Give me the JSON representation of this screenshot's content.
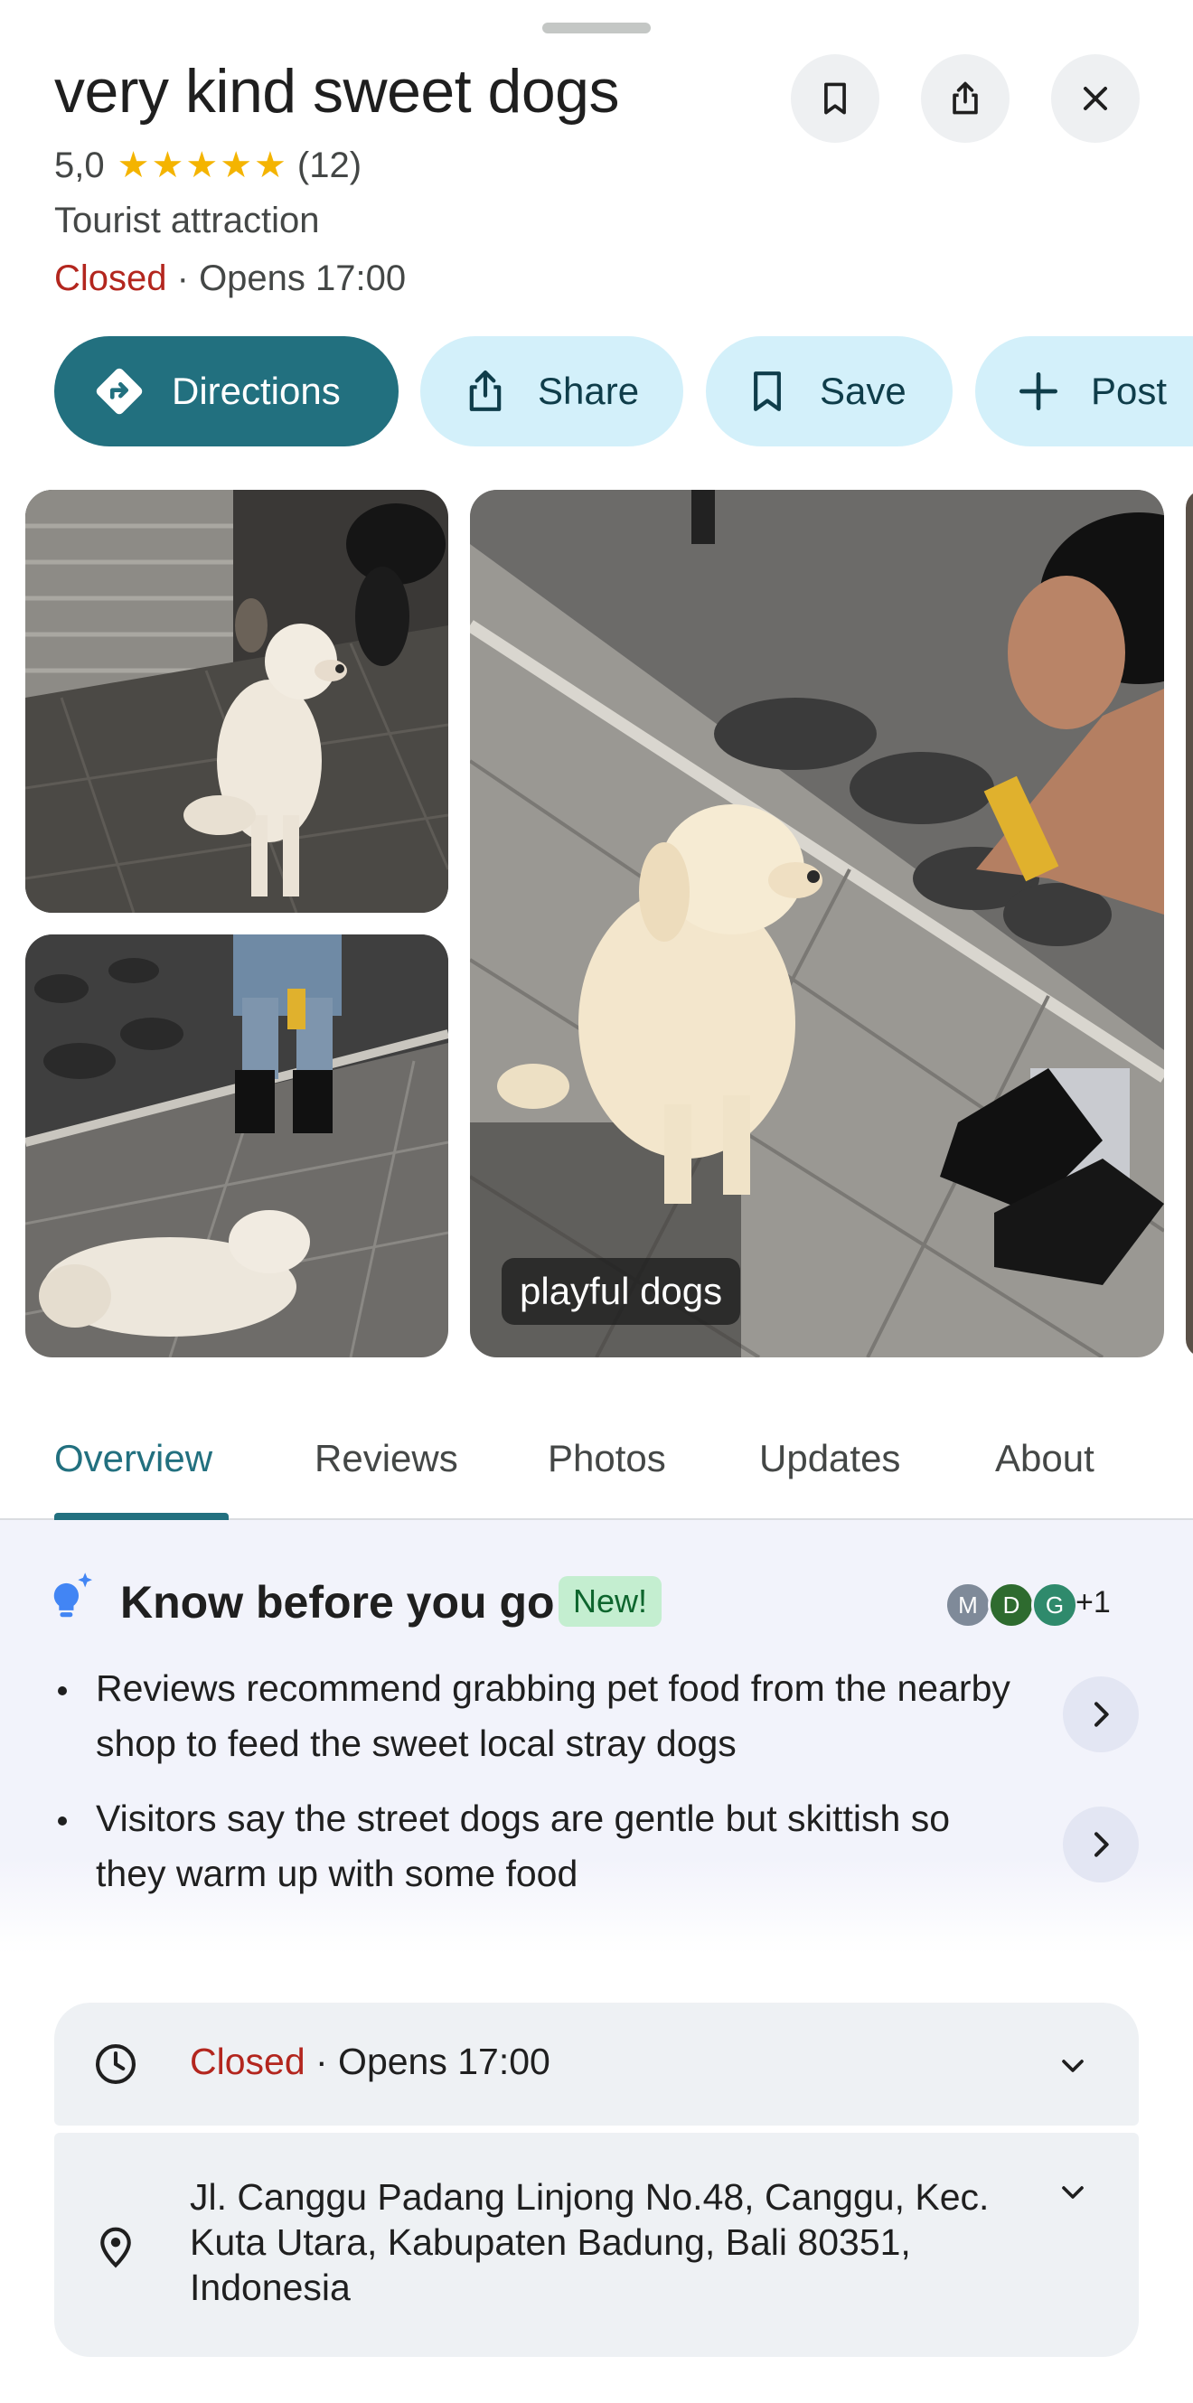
{
  "place": {
    "name": "very kind sweet dogs",
    "rating": "5,0",
    "stars": "★★★★★",
    "review_count": "(12)",
    "category": "Tourist attraction",
    "status": "Closed",
    "opens": " · Opens 17:00"
  },
  "header_buttons": [
    "bookmark-icon",
    "share-icon",
    "close-icon"
  ],
  "actions": {
    "directions": "Directions",
    "share": "Share",
    "save": "Save",
    "post": "Post"
  },
  "photos": {
    "caption": "playful dogs"
  },
  "tabs": [
    "Overview",
    "Reviews",
    "Photos",
    "Updates",
    "About"
  ],
  "active_tab": "Overview",
  "know_before_you_go": {
    "title": "Know before you go",
    "badge": "New!",
    "avatars": [
      "M",
      "D",
      "G"
    ],
    "avatar_more": "+1",
    "items": [
      "Reviews recommend grabbing pet food from the nearby shop to feed the sweet local stray dogs",
      "Visitors say the street dogs are gentle but skittish so they warm up with some food"
    ]
  },
  "info": {
    "hours_status": "Closed",
    "hours_opens": " · Opens 17:00",
    "address": "Jl. Canggu Padang Linjong No.48, Canggu, Kec. Kuta Utara, Kabupaten Badung, Bali 80351, Indonesia"
  },
  "colors": {
    "accent": "#22707f",
    "closed": "#b3261e",
    "star": "#f4b400",
    "action_bg": "#d3f0fa",
    "insight_bg": "#f2f3fb",
    "avatar_m": "#7f8a99",
    "avatar_d": "#2e6b2f",
    "avatar_g": "#2f8a6c"
  }
}
